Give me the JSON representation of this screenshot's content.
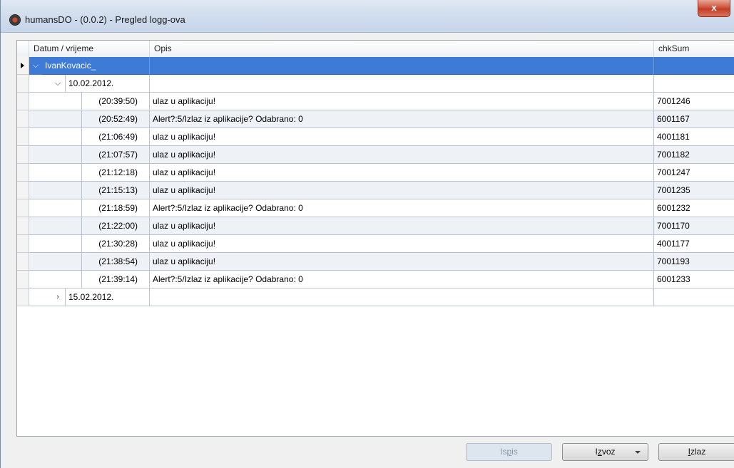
{
  "window": {
    "title": "humansDO - (0.0.2) - Pregled logg-ova",
    "close_label": "x"
  },
  "grid": {
    "columns": [
      "Datum / vrijeme",
      "Opis",
      "chkSum"
    ],
    "user": "IvanKovacic_",
    "date_expanded": "10.02.2012.",
    "entries": [
      {
        "time": "(20:39:50)",
        "desc": "ulaz u aplikaciju!",
        "chk": "7001246"
      },
      {
        "time": "(20:52:49)",
        "desc": "Alert?:5/Izlaz iz aplikacije? Odabrano: 0",
        "chk": "6001167"
      },
      {
        "time": "(21:06:49)",
        "desc": "ulaz u aplikaciju!",
        "chk": "4001181"
      },
      {
        "time": "(21:07:57)",
        "desc": "ulaz u aplikaciju!",
        "chk": "7001182"
      },
      {
        "time": "(21:12:18)",
        "desc": "ulaz u aplikaciju!",
        "chk": "7001247"
      },
      {
        "time": "(21:15:13)",
        "desc": "ulaz u aplikaciju!",
        "chk": "7001235"
      },
      {
        "time": "(21:18:59)",
        "desc": "Alert?:5/Izlaz iz aplikacije? Odabrano: 0",
        "chk": "6001232"
      },
      {
        "time": "(21:22:00)",
        "desc": "ulaz u aplikaciju!",
        "chk": "7001170"
      },
      {
        "time": "(21:30:28)",
        "desc": "ulaz u aplikaciju!",
        "chk": "4001177"
      },
      {
        "time": "(21:38:54)",
        "desc": "ulaz u aplikaciju!",
        "chk": "7001193"
      },
      {
        "time": "(21:39:14)",
        "desc": "Alert?:5/Izlaz iz aplikacije? Odabrano: 0",
        "chk": "6001233"
      }
    ],
    "date_collapsed": "15.02.2012."
  },
  "buttons": {
    "ispis": {
      "pre": "Is",
      "u": "p",
      "post": "is"
    },
    "izvoz": {
      "pre": "I",
      "u": "z",
      "post": "voz"
    },
    "izlaz": {
      "pre": "",
      "u": "I",
      "post": "zlaz"
    }
  },
  "icons": {
    "app": "app-logo-icon",
    "expand": "chevron-down-icon",
    "collapse": "chevron-right-icon",
    "row_indicator": "current-row-indicator-icon",
    "dropdown": "dropdown-arrow-icon"
  },
  "colors": {
    "selection": "#3d7bd6",
    "close_button": "#c23d26"
  }
}
